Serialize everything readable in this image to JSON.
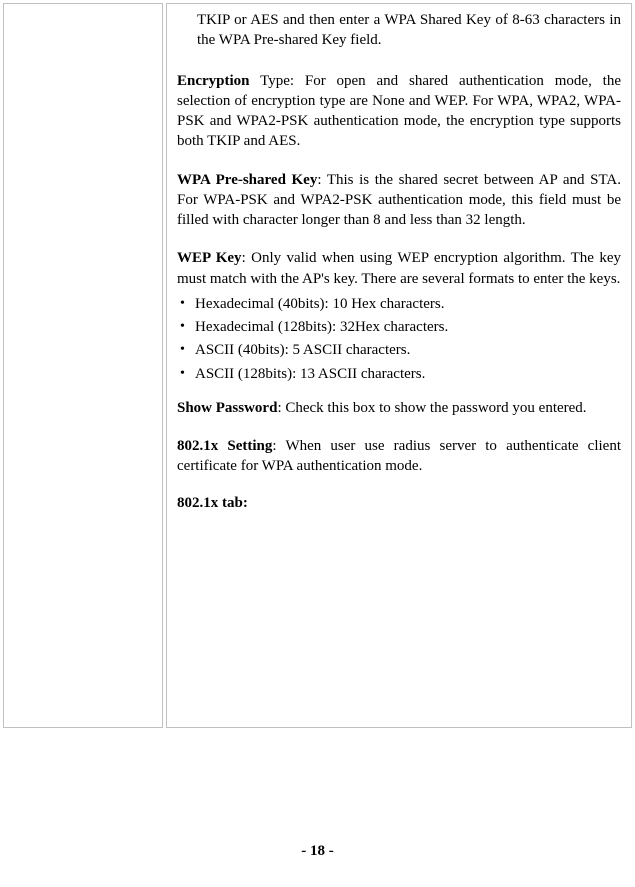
{
  "intro": "TKIP or AES and then enter a WPA Shared Key of 8-63 characters in the WPA Pre-shared Key field.",
  "encryption": {
    "label": "Encryption",
    "text": " Type: For open and shared authentication mode, the selection of encryption type are None and WEP. For WPA, WPA2, WPA-PSK and WPA2-PSK authentication mode, the encryption type supports both TKIP and AES."
  },
  "wpaKey": {
    "label": "WPA Pre-shared Key",
    "text": ": This is the shared secret between AP and STA. For WPA-PSK and WPA2-PSK authentication mode, this field must be filled with character longer than 8 and less than 32 length."
  },
  "wepKey": {
    "label": "WEP Key",
    "text": ": Only valid when using WEP encryption algorithm. The key must match with the AP's key. There are several formats to enter the keys."
  },
  "bullets": [
    "Hexadecimal (40bits): 10 Hex characters.",
    "Hexadecimal (128bits): 32Hex characters.",
    "ASCII (40bits): 5 ASCII characters.",
    "ASCII (128bits): 13 ASCII characters."
  ],
  "showPassword": {
    "label": "Show Password",
    "text": ": Check this box to show the password you entered."
  },
  "dot1xSetting": {
    "label": "802.1x Setting",
    "text": ": When user use radius server to authenticate client certificate for WPA authentication mode."
  },
  "dot1xTab": "802.1x tab:",
  "pageNumber": "- 18 -"
}
